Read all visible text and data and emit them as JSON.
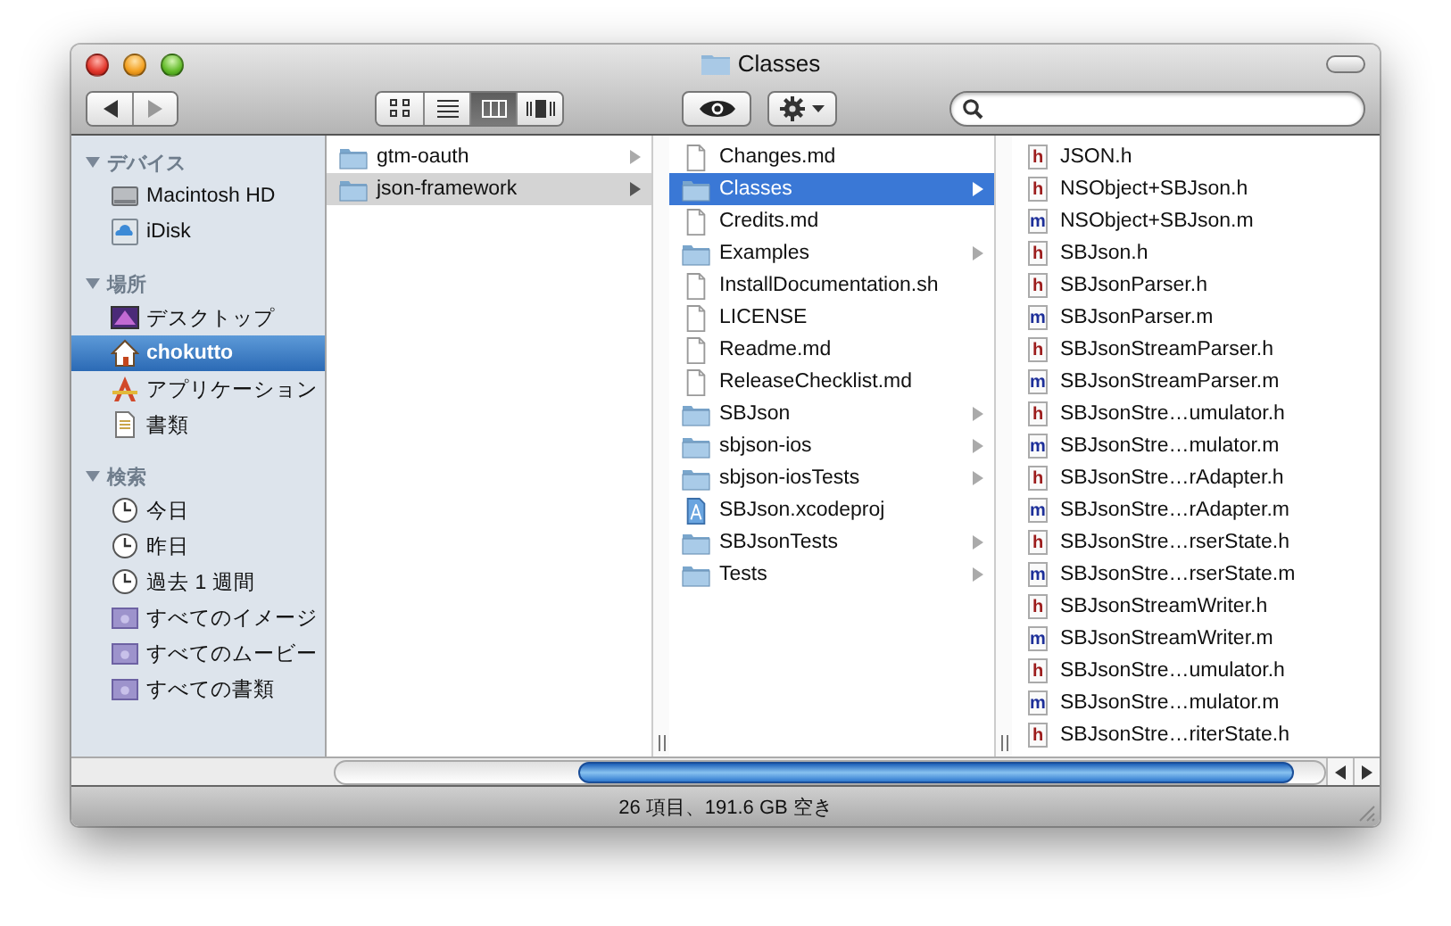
{
  "window": {
    "title": "Classes"
  },
  "toolbar": {
    "view_modes": [
      {
        "kind": "icons",
        "selected": false
      },
      {
        "kind": "list",
        "selected": false
      },
      {
        "kind": "columns",
        "selected": true
      },
      {
        "kind": "coverflow",
        "selected": false
      }
    ]
  },
  "sidebar": {
    "sections": [
      {
        "heading": "デバイス",
        "expanded": true,
        "items": [
          {
            "label": "Macintosh HD",
            "kind": "disk",
            "selected": false
          },
          {
            "label": "iDisk",
            "kind": "idisk",
            "selected": false
          }
        ]
      },
      {
        "heading": "場所",
        "expanded": true,
        "items": [
          {
            "label": "デスクトップ",
            "kind": "desktop",
            "selected": false
          },
          {
            "label": "chokutto",
            "kind": "home",
            "selected": true
          },
          {
            "label": "アプリケーション",
            "kind": "apps",
            "selected": false
          },
          {
            "label": "書類",
            "kind": "document",
            "selected": false
          }
        ]
      },
      {
        "heading": "検索",
        "expanded": true,
        "items": [
          {
            "label": "今日",
            "kind": "clock",
            "selected": false
          },
          {
            "label": "昨日",
            "kind": "clock",
            "selected": false
          },
          {
            "label": "過去 1 週間",
            "kind": "clock",
            "selected": false
          },
          {
            "label": "すべてのイメージ",
            "kind": "smartfolder",
            "selected": false
          },
          {
            "label": "すべてのムービー",
            "kind": "smartfolder",
            "selected": false
          },
          {
            "label": "すべての書類",
            "kind": "smartfolder",
            "selected": false
          }
        ]
      }
    ]
  },
  "columns": [
    {
      "focused": false,
      "items": [
        {
          "name": "gtm-oauth",
          "kind": "folder",
          "selected": false
        },
        {
          "name": "json-framework",
          "kind": "folder",
          "selected": true
        }
      ]
    },
    {
      "focused": true,
      "items": [
        {
          "name": "Changes.md",
          "kind": "file",
          "selected": false
        },
        {
          "name": "Classes",
          "kind": "folder",
          "selected": true
        },
        {
          "name": "Credits.md",
          "kind": "file",
          "selected": false
        },
        {
          "name": "Examples",
          "kind": "folder",
          "selected": false
        },
        {
          "name": "InstallDocumentation.sh",
          "kind": "file",
          "selected": false
        },
        {
          "name": "LICENSE",
          "kind": "file",
          "selected": false
        },
        {
          "name": "Readme.md",
          "kind": "file",
          "selected": false
        },
        {
          "name": "ReleaseChecklist.md",
          "kind": "file",
          "selected": false
        },
        {
          "name": "SBJson",
          "kind": "folder",
          "selected": false
        },
        {
          "name": "sbjson-ios",
          "kind": "folder",
          "selected": false
        },
        {
          "name": "sbjson-iosTests",
          "kind": "folder",
          "selected": false
        },
        {
          "name": "SBJson.xcodeproj",
          "kind": "project",
          "selected": false
        },
        {
          "name": "SBJsonTests",
          "kind": "folder",
          "selected": false
        },
        {
          "name": "Tests",
          "kind": "folder",
          "selected": false
        }
      ]
    },
    {
      "items": [
        {
          "name": "JSON.h",
          "kind": "header",
          "badge": "h",
          "selected": false
        },
        {
          "name": "NSObject+SBJson.h",
          "kind": "header",
          "badge": "h",
          "selected": false
        },
        {
          "name": "NSObject+SBJson.m",
          "kind": "source",
          "badge": "m",
          "selected": false
        },
        {
          "name": "SBJson.h",
          "kind": "header",
          "badge": "h",
          "selected": false
        },
        {
          "name": "SBJsonParser.h",
          "kind": "header",
          "badge": "h",
          "selected": false
        },
        {
          "name": "SBJsonParser.m",
          "kind": "source",
          "badge": "m",
          "selected": false
        },
        {
          "name": "SBJsonStreamParser.h",
          "kind": "header",
          "badge": "h",
          "selected": false
        },
        {
          "name": "SBJsonStreamParser.m",
          "kind": "source",
          "badge": "m",
          "selected": false
        },
        {
          "name": "SBJsonStre…umulator.h",
          "kind": "header",
          "badge": "h",
          "selected": false
        },
        {
          "name": "SBJsonStre…mulator.m",
          "kind": "source",
          "badge": "m",
          "selected": false
        },
        {
          "name": "SBJsonStre…rAdapter.h",
          "kind": "header",
          "badge": "h",
          "selected": false
        },
        {
          "name": "SBJsonStre…rAdapter.m",
          "kind": "source",
          "badge": "m",
          "selected": false
        },
        {
          "name": "SBJsonStre…rserState.h",
          "kind": "header",
          "badge": "h",
          "selected": false
        },
        {
          "name": "SBJsonStre…rserState.m",
          "kind": "source",
          "badge": "m",
          "selected": false
        },
        {
          "name": "SBJsonStreamWriter.h",
          "kind": "header",
          "badge": "h",
          "selected": false
        },
        {
          "name": "SBJsonStreamWriter.m",
          "kind": "source",
          "badge": "m",
          "selected": false
        },
        {
          "name": "SBJsonStre…umulator.h",
          "kind": "header",
          "badge": "h",
          "selected": false
        },
        {
          "name": "SBJsonStre…mulator.m",
          "kind": "source",
          "badge": "m",
          "selected": false
        },
        {
          "name": "SBJsonStre…riterState.h",
          "kind": "header",
          "badge": "h",
          "selected": false
        }
      ]
    }
  ],
  "status_bar": "26 項目、191.6 GB 空き"
}
